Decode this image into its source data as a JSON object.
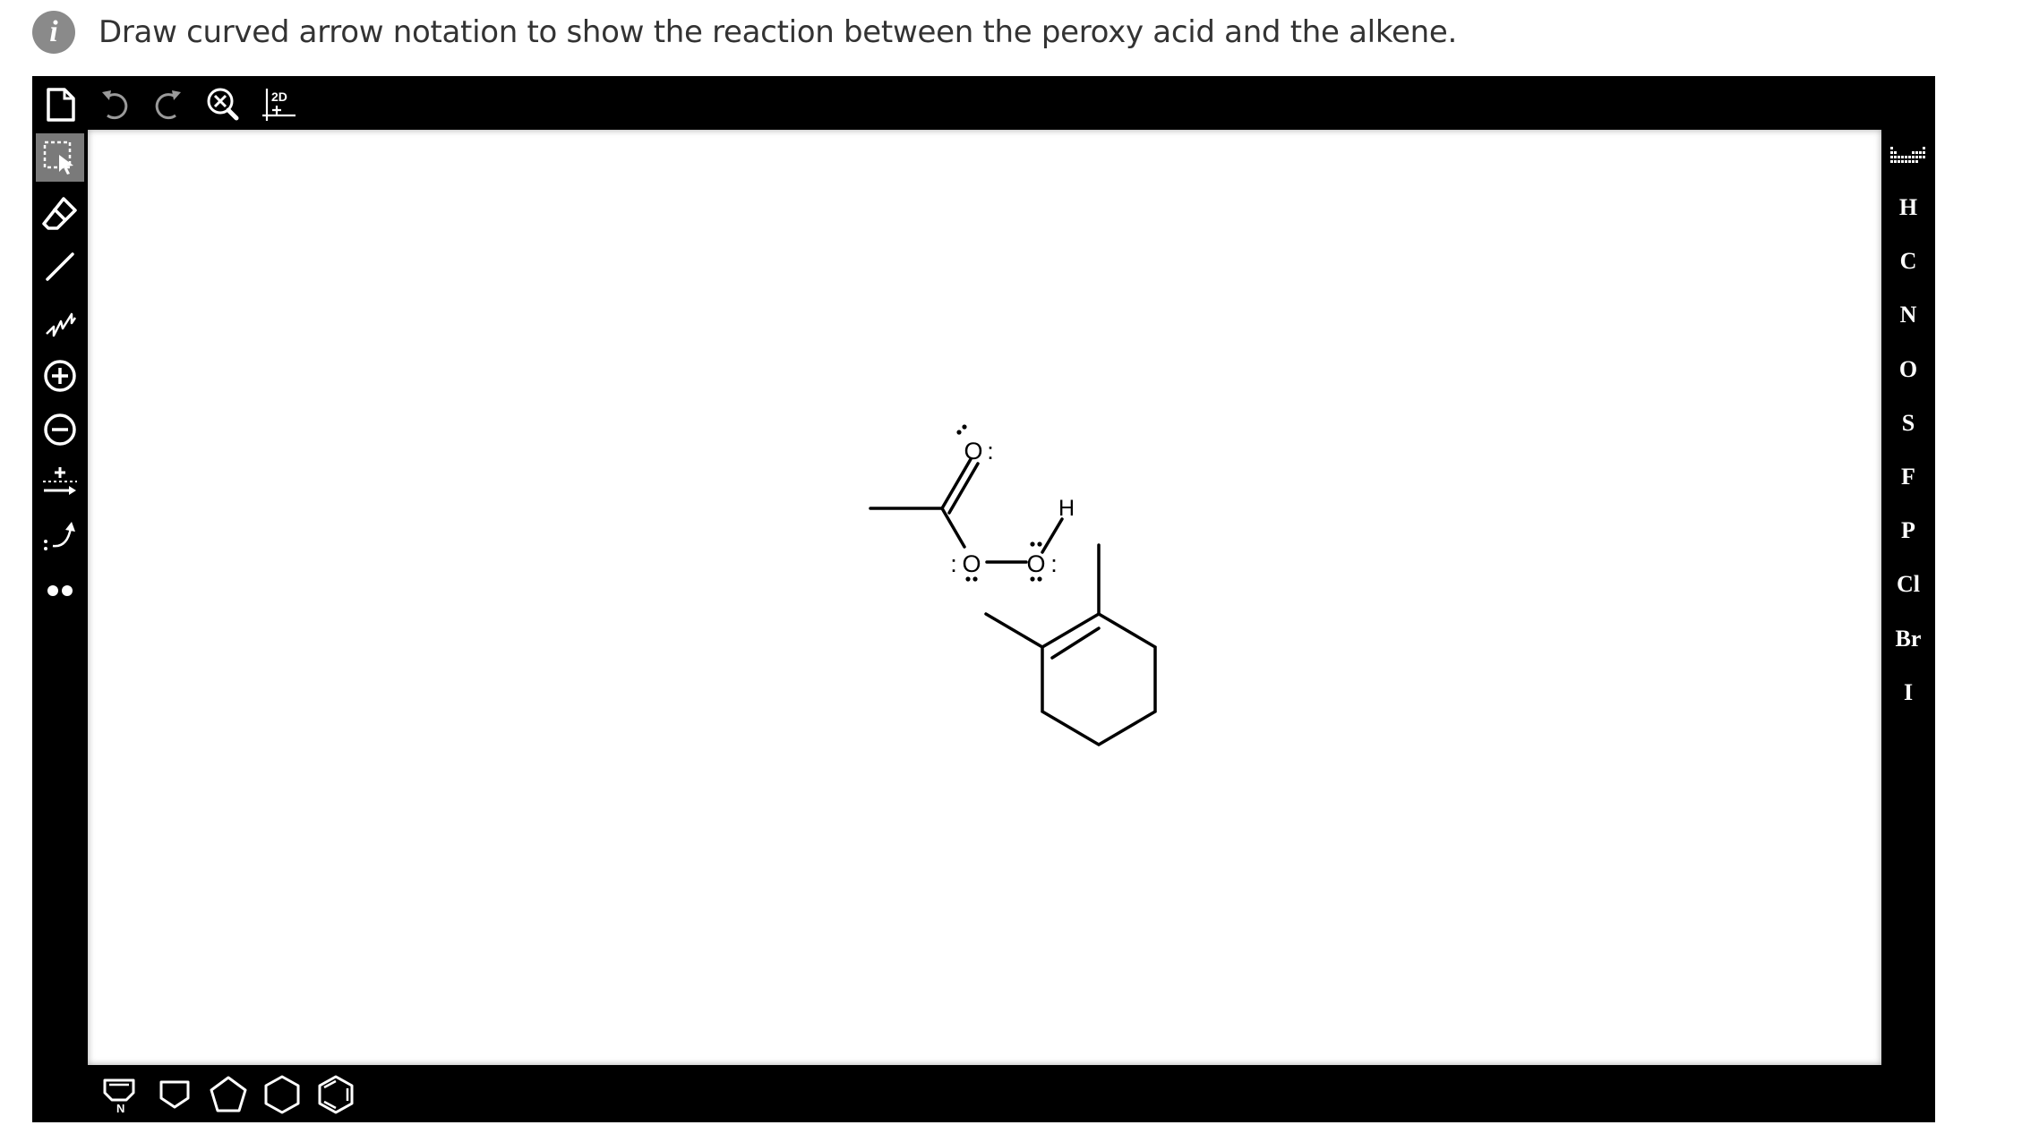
{
  "prompt": {
    "info_icon_glyph": "i",
    "text": "Draw curved arrow notation to show the reaction between the peroxy acid and the alkene."
  },
  "top_toolbar": {
    "icons": [
      "new-document-icon",
      "undo-icon",
      "redo-icon",
      "zoom-clear-icon",
      "2d-cleanup-icon"
    ],
    "cleanup_label": "2D"
  },
  "left_toolbar": {
    "active_tool": "select",
    "icons": [
      "select-icon",
      "eraser-icon",
      "bond-icon",
      "chain-icon",
      "positive-charge-icon",
      "negative-charge-icon",
      "reaction-arrow-icon",
      "curved-arrow-icon",
      "lone-pair-icon"
    ]
  },
  "right_toolbar": {
    "icons": [
      "periodic-table-icon"
    ],
    "elements": [
      "H",
      "C",
      "N",
      "O",
      "S",
      "F",
      "P",
      "Cl",
      "Br",
      "I"
    ]
  },
  "bottom_toolbar": {
    "icons": [
      "pyrrole-ring-icon",
      "cyclobutane-ring-icon",
      "cyclopentane-ring-icon",
      "cyclohexane-ring-icon",
      "benzene-ring-icon"
    ],
    "pyrrole_label": "N"
  },
  "molecule": {
    "atom_labels": {
      "carbonyl_o": "O",
      "ester_o": "O",
      "hydroxyl_o": "O",
      "hydrogen": "H"
    },
    "lone_pair_glyph": ":"
  },
  "colors": {
    "toolbar_bg": "#000000",
    "canvas_bg": "#ffffff",
    "icon": "#ffffff",
    "active_tool_bg": "#7a7a7a",
    "info_icon_bg": "#8a8a8a",
    "prompt_text": "#333333"
  }
}
